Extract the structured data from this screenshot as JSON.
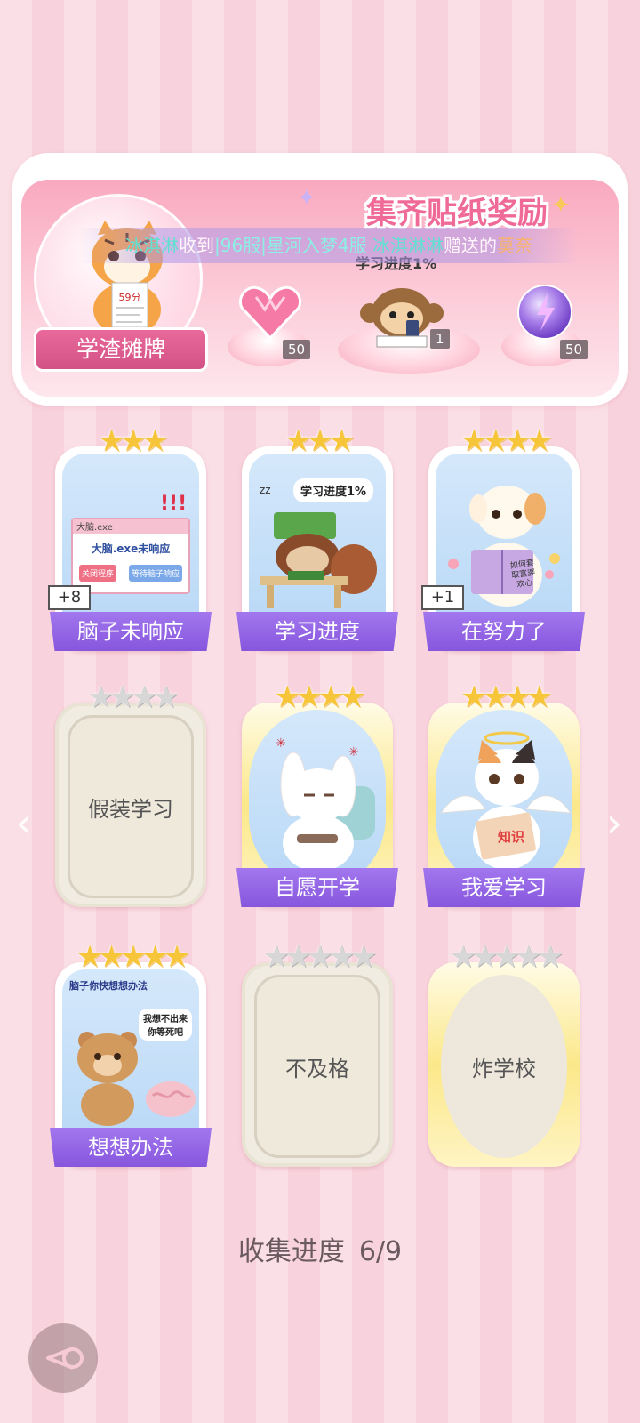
{
  "banner": {
    "title": "集齐贴纸奖励",
    "badge_label": "学渣摊牌",
    "note_score": "59分",
    "mini_progress": "学习进度1%",
    "rewards": [
      {
        "icon": "heart-gem-icon",
        "count": "50"
      },
      {
        "icon": "monkey-sticker-icon",
        "count": "1"
      },
      {
        "icon": "lightning-orb-icon",
        "count": "50"
      }
    ]
  },
  "ticker": {
    "user1": "冰淇淋",
    "text1": "收到",
    "server": "|96服|星河入梦4服",
    "user2": "冰淇淋淋",
    "text2": "赠送的",
    "gift": "莫奈"
  },
  "cards": [
    {
      "label": "脑子未响应",
      "stars": 3,
      "plus": "+8",
      "window_title": "大脑.exe",
      "window_msg": "大脑.exe未响应",
      "btn1": "关闭程序",
      "btn2": "等待脑子响应"
    },
    {
      "label": "学习进度",
      "stars": 3,
      "bubble": "学习进度1%"
    },
    {
      "label": "在努力了",
      "stars": 4,
      "plus": "+1",
      "book": "如何套取富婆欢心"
    },
    {
      "label": "假装学习",
      "stars": 4
    },
    {
      "label": "自愿开学",
      "stars": 4
    },
    {
      "label": "我爱学习",
      "stars": 4,
      "book": "知识"
    },
    {
      "label": "想想办法",
      "stars": 5,
      "bubble1": "脑子你快想想办法",
      "bubble2": "我想不出来你等死吧"
    },
    {
      "label": "不及格",
      "stars": 5
    },
    {
      "label": "炸学校",
      "stars": 5
    }
  ],
  "progress": {
    "label": "收集进度",
    "value": "6/9"
  },
  "colors": {
    "accent": "#f06a98",
    "ribbon": "#8756dd",
    "star": "#f7c53a"
  }
}
